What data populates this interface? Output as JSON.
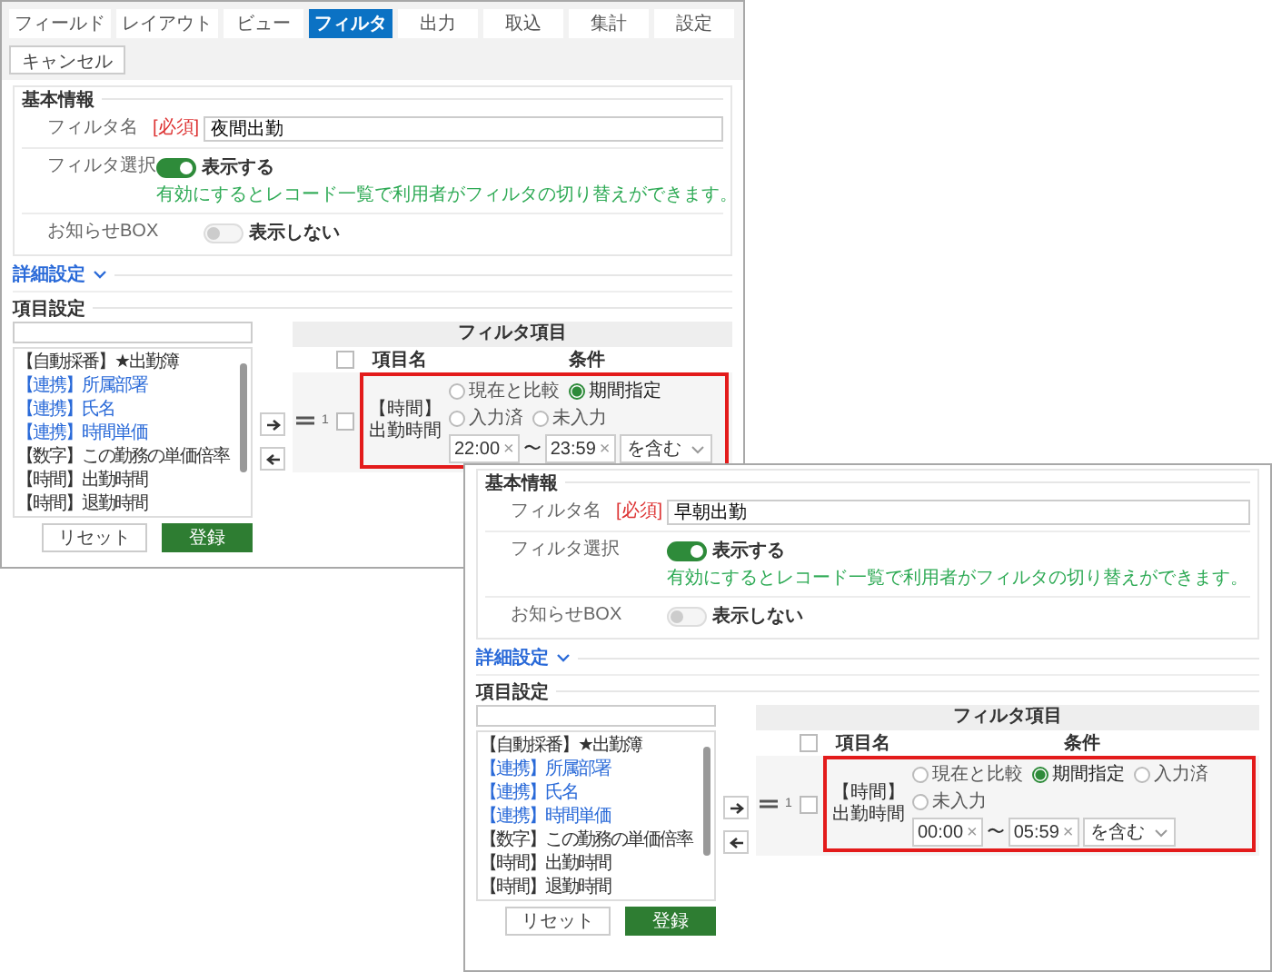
{
  "windows": [
    {
      "tabs": [
        {
          "label": "フィールド",
          "selected": false
        },
        {
          "label": "レイアウト",
          "selected": false
        },
        {
          "label": "ビュー",
          "selected": false
        },
        {
          "label": "フィルタ",
          "selected": true
        },
        {
          "label": "出力",
          "selected": false
        },
        {
          "label": "取込",
          "selected": false
        },
        {
          "label": "集計",
          "selected": false
        },
        {
          "label": "設定",
          "selected": false
        }
      ],
      "cancel_button": "キャンセル",
      "basic_info": {
        "title": "基本情報",
        "filter_name": {
          "label": "フィルタ名",
          "required": "[必須]",
          "value": "夜間出勤"
        },
        "filter_select": {
          "label": "フィルタ選択",
          "on": true,
          "text": "表示する",
          "hint": "有効にするとレコード一覧で利用者がフィルタの切り替えができます。"
        },
        "notice_box": {
          "label": "お知らせBOX",
          "on": false,
          "text": "表示しない"
        }
      },
      "details": {
        "title": "詳細設定"
      },
      "item_settings": {
        "title": "項目設定",
        "fields": [
          {
            "label": "【自動採番】★出勤簿",
            "kind": "plain"
          },
          {
            "label": "【連携】所属部署",
            "kind": "linked"
          },
          {
            "label": "【連携】氏名",
            "kind": "linked"
          },
          {
            "label": "【連携】時間単価",
            "kind": "linked"
          },
          {
            "label": "【数字】この勤務の単価倍率",
            "kind": "plain"
          },
          {
            "label": "【時間】出勤時間",
            "kind": "plain"
          },
          {
            "label": "【時間】退勤時間",
            "kind": "plain"
          }
        ],
        "filter_table": {
          "title": "フィルタ項目",
          "columns": [
            "項目名",
            "条件"
          ],
          "header_checked": false,
          "rows": [
            {
              "number": "1",
              "checked": false,
              "name": "【時間】出勤時間",
              "options": [
                {
                  "label": "現在と比較",
                  "selected": false
                },
                {
                  "label": "期間指定",
                  "selected": true
                },
                {
                  "label": "入力済",
                  "selected": false
                },
                {
                  "label": "未入力",
                  "selected": false
                }
              ],
              "from": {
                "value": "22:00",
                "clear": "×"
              },
              "separator": "〜",
              "to": {
                "value": "23:59",
                "clear": "×"
              },
              "match": "を含む",
              "highlighted": true
            }
          ]
        }
      },
      "buttons": {
        "reset": "リセット",
        "submit": "登録"
      }
    },
    {
      "basic_info": {
        "title": "基本情報",
        "filter_name": {
          "label": "フィルタ名",
          "required": "[必須]",
          "value": "早朝出勤"
        },
        "filter_select": {
          "label": "フィルタ選択",
          "on": true,
          "text": "表示する",
          "hint": "有効にするとレコード一覧で利用者がフィルタの切り替えができます。"
        },
        "notice_box": {
          "label": "お知らせBOX",
          "on": false,
          "text": "表示しない"
        }
      },
      "details": {
        "title": "詳細設定"
      },
      "item_settings": {
        "title": "項目設定",
        "fields": [
          {
            "label": "【自動採番】★出勤簿",
            "kind": "plain"
          },
          {
            "label": "【連携】所属部署",
            "kind": "linked"
          },
          {
            "label": "【連携】氏名",
            "kind": "linked"
          },
          {
            "label": "【連携】時間単価",
            "kind": "linked"
          },
          {
            "label": "【数字】この勤務の単価倍率",
            "kind": "plain"
          },
          {
            "label": "【時間】出勤時間",
            "kind": "plain"
          },
          {
            "label": "【時間】退勤時間",
            "kind": "plain"
          }
        ],
        "filter_table": {
          "title": "フィルタ項目",
          "columns": [
            "項目名",
            "条件"
          ],
          "header_checked": false,
          "rows": [
            {
              "number": "1",
              "checked": false,
              "name": "【時間】出勤時間",
              "options": [
                {
                  "label": "現在と比較",
                  "selected": false
                },
                {
                  "label": "期間指定",
                  "selected": true
                },
                {
                  "label": "入力済",
                  "selected": false
                },
                {
                  "label": "未入力",
                  "selected": false
                }
              ],
              "from": {
                "value": "00:00",
                "clear": "×"
              },
              "separator": "〜",
              "to": {
                "value": "05:59",
                "clear": "×"
              },
              "match": "を含む",
              "highlighted": true
            }
          ]
        }
      },
      "buttons": {
        "reset": "リセット",
        "submit": "登録"
      }
    }
  ]
}
